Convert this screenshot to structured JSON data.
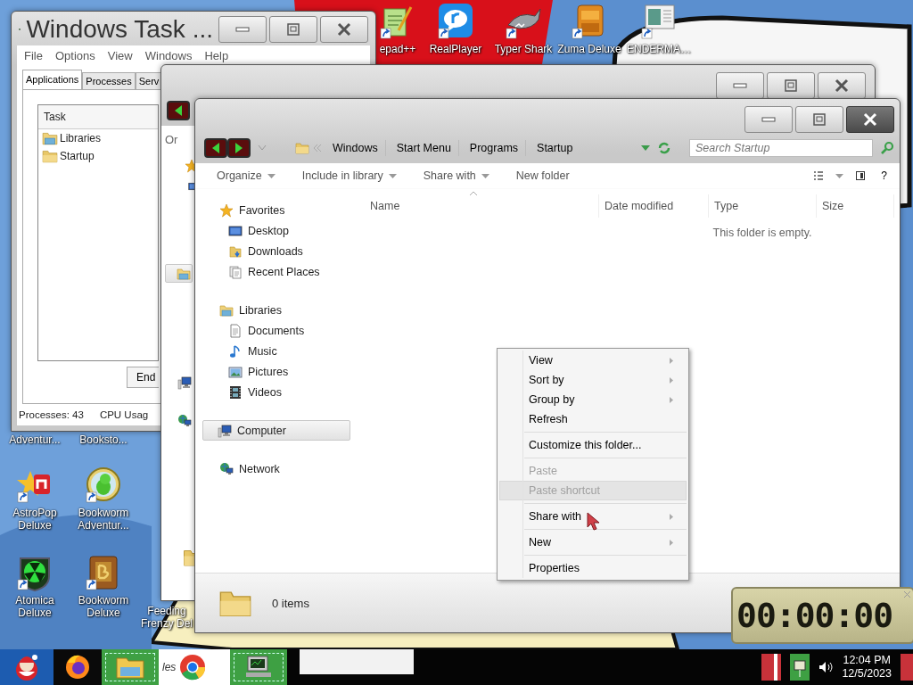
{
  "desktop_icons": [
    {
      "label": "epad++",
      "kind": "notepad"
    },
    {
      "label": "RealPlayer",
      "kind": "realplayer"
    },
    {
      "label": "Typer Shark",
      "kind": "shark"
    },
    {
      "label": "Zuma Deluxe",
      "kind": "zuma"
    },
    {
      "label": "ENDERMA…",
      "kind": "window"
    },
    {
      "label": "Adventur..."
    },
    {
      "label": "Booksto..."
    },
    {
      "label": "AstroPop Deluxe",
      "kind": "astropop"
    },
    {
      "label": "Bookworm Adventur...",
      "kind": "bookworm"
    },
    {
      "label": "Atomica Deluxe",
      "kind": "atomica"
    },
    {
      "label": "Bookworm Deluxe",
      "kind": "book"
    },
    {
      "label": "Feeding Frenzy Del"
    }
  ],
  "task_manager": {
    "title": "Windows Task ...",
    "active": false,
    "menu": [
      "File",
      "Options",
      "View",
      "Windows",
      "Help"
    ],
    "tabs": [
      {
        "label": "Applications",
        "selected": true
      },
      {
        "label": "Processes",
        "selected": false
      },
      {
        "label": "Serv",
        "selected": false
      }
    ],
    "column": "Task",
    "rows": [
      {
        "label": "Libraries",
        "kind": "library"
      },
      {
        "label": "Startup",
        "kind": "folder"
      }
    ],
    "end_button": "End",
    "status": [
      "Processes: 43",
      "CPU Usag"
    ]
  },
  "back_window": {
    "active": false,
    "toolbar_text": "Or"
  },
  "explorer": {
    "active": true,
    "path": [
      "Windows",
      "Start Menu",
      "Programs",
      "Startup"
    ],
    "search": {
      "placeholder": "Search Startup"
    },
    "toolbar": [
      {
        "label": "Organize",
        "menu": true
      },
      {
        "label": "Include in library",
        "menu": true
      },
      {
        "label": "Share with",
        "menu": true
      },
      {
        "label": "New folder",
        "menu": false
      }
    ],
    "help": "?",
    "columns": [
      "Name",
      "Date modified",
      "Type",
      "Size"
    ],
    "empty_text": "This folder is empty.",
    "nav": [
      {
        "label": "Favorites",
        "kind": "star",
        "selected": false,
        "children": [
          {
            "label": "Desktop",
            "kind": "desktop",
            "selected": false
          },
          {
            "label": "Downloads",
            "kind": "downloads",
            "selected": false
          },
          {
            "label": "Recent Places",
            "kind": "recent",
            "selected": false
          }
        ]
      },
      {
        "label": "Libraries",
        "kind": "library",
        "selected": false,
        "children": [
          {
            "label": "Documents",
            "kind": "document",
            "selected": false
          },
          {
            "label": "Music",
            "kind": "music",
            "selected": false
          },
          {
            "label": "Pictures",
            "kind": "pictures",
            "selected": false
          },
          {
            "label": "Videos",
            "kind": "videos",
            "selected": false
          }
        ]
      },
      {
        "label": "Computer",
        "kind": "computer",
        "selected": true
      },
      {
        "label": "Network",
        "kind": "network",
        "selected": false
      }
    ],
    "status": "0 items"
  },
  "context_menu": {
    "items": [
      {
        "label": "View",
        "kind": "submenu",
        "disabled": false,
        "selected": false
      },
      {
        "label": "Sort by",
        "kind": "submenu",
        "disabled": false,
        "selected": false
      },
      {
        "label": "Group by",
        "kind": "submenu",
        "disabled": false,
        "selected": false
      },
      {
        "label": "Refresh",
        "kind": "item",
        "disabled": false,
        "selected": false
      },
      {
        "kind": "separator"
      },
      {
        "label": "Customize this folder...",
        "kind": "item",
        "disabled": false,
        "selected": false
      },
      {
        "kind": "separator"
      },
      {
        "label": "Paste",
        "kind": "item",
        "disabled": true,
        "selected": false
      },
      {
        "label": "Paste shortcut",
        "kind": "item",
        "disabled": true,
        "selected": true
      },
      {
        "kind": "separator"
      },
      {
        "label": "Share with",
        "kind": "submenu",
        "disabled": false,
        "selected": false
      },
      {
        "kind": "separator"
      },
      {
        "label": "New",
        "kind": "submenu",
        "disabled": false,
        "selected": false
      },
      {
        "kind": "separator"
      },
      {
        "label": "Properties",
        "kind": "item",
        "disabled": false,
        "selected": false
      }
    ]
  },
  "stopwatch": {
    "time": "00:00:00"
  },
  "taskbar": {
    "buttons": [
      {
        "kind": "start",
        "active": false
      },
      {
        "kind": "firefox",
        "active": false
      },
      {
        "kind": "explorer",
        "active": true
      },
      {
        "kind": "chrome",
        "active": false,
        "label": "les"
      },
      {
        "kind": "taskmgr",
        "active": true
      }
    ],
    "time": "12:04 PM",
    "date": "12/5/2023"
  }
}
